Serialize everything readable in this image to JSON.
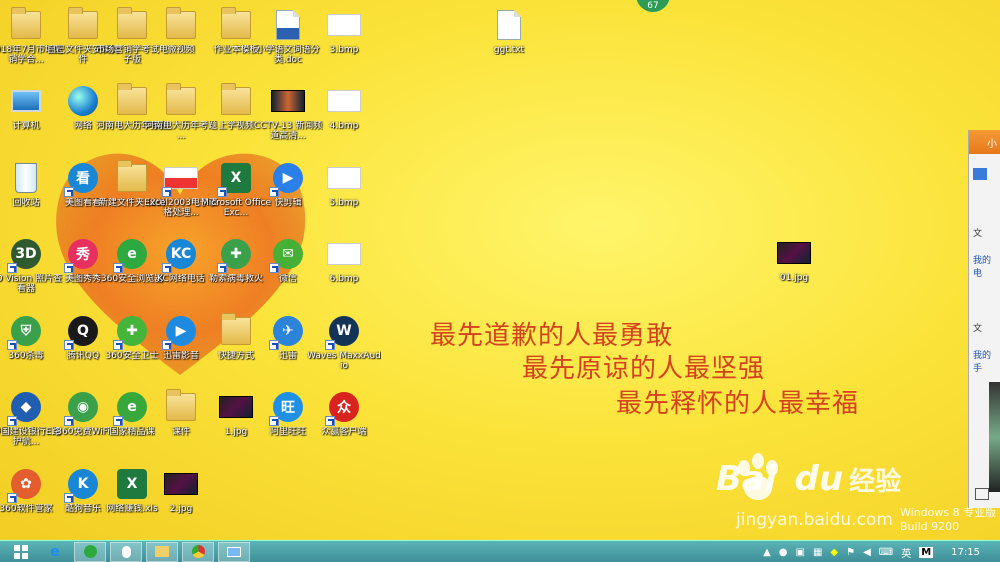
{
  "desktop_icons": [
    {
      "label": "2018年7月市场营销学合...",
      "type": "folder"
    },
    {
      "label": "自己文件夹安装文件",
      "type": "folder"
    },
    {
      "label": "市场营销学考试电子版",
      "type": "folder"
    },
    {
      "label": "微视频",
      "type": "folder"
    },
    {
      "label": "作业本模板",
      "type": "folder"
    },
    {
      "label": "小学语文词语分类.doc",
      "type": "word"
    },
    {
      "label": "3.bmp",
      "type": "bmp"
    },
    {
      "label": "计算机",
      "type": "computer"
    },
    {
      "label": "网络",
      "type": "network"
    },
    {
      "label": "河南电大历年考题",
      "type": "folder"
    },
    {
      "label": "河南电大历年考题 ...",
      "type": "folder"
    },
    {
      "label": "上学视频",
      "type": "folder"
    },
    {
      "label": "CCTV-13 新闻频道高清...",
      "type": "video"
    },
    {
      "label": "4.bmp",
      "type": "bmp"
    },
    {
      "label": "回收站",
      "type": "recycle"
    },
    {
      "label": "美图看看",
      "type": "app",
      "color": "#1a86d6",
      "glyph": "看"
    },
    {
      "label": "新建文件夹 (20)",
      "type": "folder"
    },
    {
      "label": "Excel2003电子表格处理...",
      "type": "thumb"
    },
    {
      "label": "Microsoft Office Exc...",
      "type": "excel"
    },
    {
      "label": "快剪辑",
      "type": "app",
      "color": "#2a7fe8",
      "glyph": "▶"
    },
    {
      "label": "5.bmp",
      "type": "bmp"
    },
    {
      "label": "3D Vision 照片查看器",
      "type": "app",
      "color": "#2f5a2f",
      "glyph": "3D"
    },
    {
      "label": "美图秀秀",
      "type": "app",
      "color": "#e83060",
      "glyph": "秀"
    },
    {
      "label": "360安全浏览器",
      "type": "app",
      "color": "#2ea940",
      "glyph": "e"
    },
    {
      "label": "KC网络电话",
      "type": "app",
      "color": "#1a86d6",
      "glyph": "KC"
    },
    {
      "label": "勒索病毒救火",
      "type": "app",
      "color": "#3aa14a",
      "glyph": "✚"
    },
    {
      "label": "微信",
      "type": "app",
      "color": "#45b035",
      "glyph": "✉"
    },
    {
      "label": "6.bmp",
      "type": "bmp"
    },
    {
      "label": "360杀毒",
      "type": "app",
      "color": "#3aa14a",
      "glyph": "⛨"
    },
    {
      "label": "腾讯QQ",
      "type": "app",
      "color": "#1a1a1a",
      "glyph": "Q"
    },
    {
      "label": "360安全卫士",
      "type": "app",
      "color": "#44b53a",
      "glyph": "✚"
    },
    {
      "label": "迅雷影音",
      "type": "app",
      "color": "#1f8be0",
      "glyph": "▶"
    },
    {
      "label": "快捷方式",
      "type": "folder"
    },
    {
      "label": "迅雷",
      "type": "app",
      "color": "#2c84d9",
      "glyph": "✈"
    },
    {
      "label": "Waves MaxxAudio",
      "type": "app",
      "color": "#123456",
      "glyph": "W"
    },
    {
      "label": "中国建设银行E路护航...",
      "type": "app",
      "color": "#1f5eb0",
      "glyph": "◆"
    },
    {
      "label": "360免费WiFi",
      "type": "app",
      "color": "#3aa14a",
      "glyph": "◉"
    },
    {
      "label": "国家精品课",
      "type": "app",
      "color": "#38a83d",
      "glyph": "e"
    },
    {
      "label": "课件",
      "type": "folder"
    },
    {
      "label": "1.jpg",
      "type": "jpg"
    },
    {
      "label": "阿里旺旺",
      "type": "app",
      "color": "#1e90e6",
      "glyph": "旺"
    },
    {
      "label": "众赢客户端",
      "type": "app",
      "color": "#d8231f",
      "glyph": "众"
    },
    {
      "label": "360软件管家",
      "type": "app",
      "color": "#e35d2d",
      "glyph": "✿"
    },
    {
      "label": "酷狗音乐",
      "type": "app",
      "color": "#1a86d6",
      "glyph": "K"
    },
    {
      "label": "网络赚钱.xls",
      "type": "excel"
    },
    {
      "label": "2.jpg",
      "type": "jpg"
    },
    {
      "label": "ggt.txt",
      "type": "txt"
    },
    {
      "label": "01.jpg",
      "type": "jpg"
    }
  ],
  "quote_lines": [
    "最先道歉的人最勇敢",
    "最先原谅的人最坚强",
    "最先释怀的人最幸福"
  ],
  "baidu": {
    "logo_text": "Bai",
    "logo_text2": "du",
    "jingyan": "经验",
    "url": "jingyan.baidu.com"
  },
  "os_watermark": {
    "line1": "Windows 8 专业版",
    "line2": "Build 9200"
  },
  "notification_badge": "67",
  "chat_window": {
    "title": "小",
    "row1": "文",
    "row2": "我的电",
    "row3": "文",
    "row4": "我的手"
  },
  "taskbar": {
    "clock": "17:15",
    "ime_label": "英",
    "ime_mode": "M",
    "buttons": [
      "start",
      "ie",
      "360browser",
      "qq",
      "explorer",
      "chrome",
      "remote"
    ]
  },
  "colors": {
    "quote": "#d4421e",
    "taskbar": "#4aa3a8",
    "desktop": "#fbe33a"
  }
}
